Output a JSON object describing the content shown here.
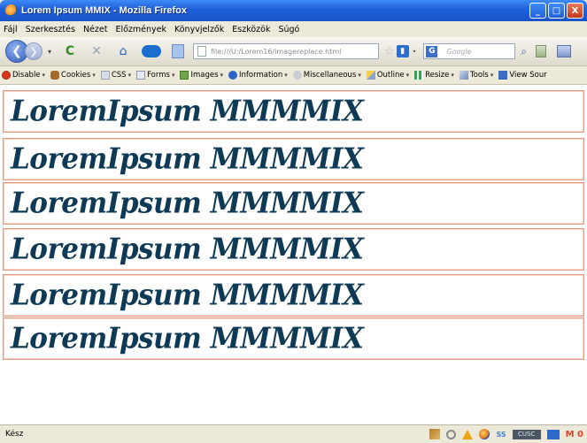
{
  "window": {
    "title": "Lorem Ipsum MMIX - Mozilla Firefox",
    "controls": {
      "minimize": "_",
      "maximize": "□",
      "close": "X"
    }
  },
  "menu": [
    "Fájl",
    "Szerkesztés",
    "Nézet",
    "Előzmények",
    "Könyvjelzők",
    "Eszközök",
    "Súgó"
  ],
  "nav": {
    "url": "file:///U:/Lorem16/imagereplace.html",
    "search_placeholder": "Google",
    "search_engine_letter": "G",
    "back_glyph": "❮",
    "forward_glyph": "❯",
    "reload_glyph": "C",
    "stop_glyph": "✕",
    "home_glyph": "⌂",
    "star_glyph": "☆",
    "search_go_glyph": "⌕",
    "caret_glyph": "▾",
    "dot_glyph": "•",
    "feed_glyph": "▮"
  },
  "devtoolbar": {
    "items": [
      "Disable",
      "Cookies",
      "CSS",
      "Forms",
      "Images",
      "Information",
      "Miscellaneous",
      "Outline",
      "Resize",
      "Tools",
      "View Sour"
    ],
    "caret": "▾"
  },
  "content": {
    "lines": [
      "LoremIpsum MMMMIX",
      "LoremIpsum MMMMIX",
      "LoremIpsum MMMMIX",
      "LoremIpsum MMMMIX",
      "LoremIpsum MMMMIX",
      "LoremIpsum MMMMIX"
    ],
    "line_text": "LoremIpsum MMMMIX"
  },
  "status": {
    "text": "Kész",
    "ss_label": "SS",
    "css_badge": "CUSC",
    "mail_label": "M 0"
  },
  "colors": {
    "titlebar": "#1f5fd9",
    "lorem_text": "#0f3a56",
    "box_border": "#e69a82"
  },
  "icons": {
    "app": "firefox-icon",
    "nav": [
      "back-icon",
      "forward-icon",
      "reload-icon",
      "stop-icon",
      "home-icon",
      "bookmark-star-icon",
      "search-go-icon"
    ],
    "dev": [
      "disable-icon",
      "cookies-icon",
      "css-icon",
      "forms-icon",
      "images-icon",
      "information-icon",
      "miscellaneous-icon",
      "outline-icon",
      "resize-icon",
      "tools-icon",
      "view-source-icon"
    ]
  }
}
